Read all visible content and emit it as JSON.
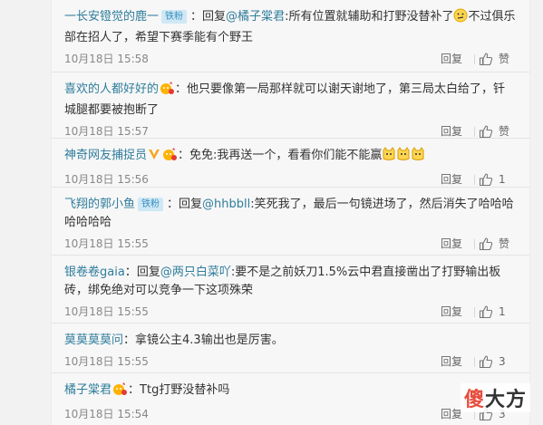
{
  "comments": [
    {
      "user": "一长安镫觉的鹿一",
      "badge": "铁粉",
      "sep": "：",
      "reply_label": "回复",
      "reply_to": "@橘子棠君",
      "text_a": ":所有位置就辅助和打野没替补了",
      "text_b": "不过俱乐部在招人了，希望下赛季能有个野王",
      "time": "10月18日 15:58",
      "reply_btn": "回复",
      "like": "赞"
    },
    {
      "user": "喜欢的人都好好的",
      "sep": "：",
      "text": "他只要像第一局那样就可以谢天谢地了，第三局太白给了，钎城腿都要被抱断了",
      "time": "10月18日 15:57",
      "reply_btn": "回复",
      "like": "赞"
    },
    {
      "user": "神奇网友捕捉员",
      "sep": "：",
      "text": "免免:我再送一个，看看你们能不能赢",
      "time": "10月18日 15:56",
      "reply_btn": "回复",
      "like": "1"
    },
    {
      "user": "飞翔的郭小鱼",
      "badge": "铁粉",
      "sep": "：",
      "reply_label": "回复",
      "reply_to": "@hhbbll",
      "text": ":笑死我了，最后一句镜进场了，然后消失了哈哈哈哈哈哈哈",
      "time": "10月18日 15:55",
      "reply_btn": "回复",
      "like": "赞"
    },
    {
      "user": "银卷卷gaia",
      "sep": "：",
      "reply_label": "回复",
      "reply_to": "@两只白菜吖",
      "text": ":要不是之前妖刀1.5%云中君直接凿出了打野输出板砖，绑免绝对可以竞争一下这项殊荣",
      "time": "10月18日 15:55",
      "reply_btn": "回复",
      "like": "1"
    },
    {
      "user": "莫莫莫莫问",
      "sep": "：",
      "text": "拿镜公主4.3输出也是厉害。",
      "time": "10月18日 15:55",
      "reply_btn": "回复",
      "like": "3"
    },
    {
      "user": "橘子棠君",
      "sep": "：",
      "text": "Ttg打野没替补吗",
      "time": "10月18日 15:54",
      "reply_btn": "回复",
      "like": "3"
    }
  ],
  "watermark": {
    "red": "傻",
    "black": "大方"
  },
  "colors": {
    "link": "#2f7d9b",
    "badge_bg": "#cfe8f5",
    "watermark": "#e74c3c"
  }
}
